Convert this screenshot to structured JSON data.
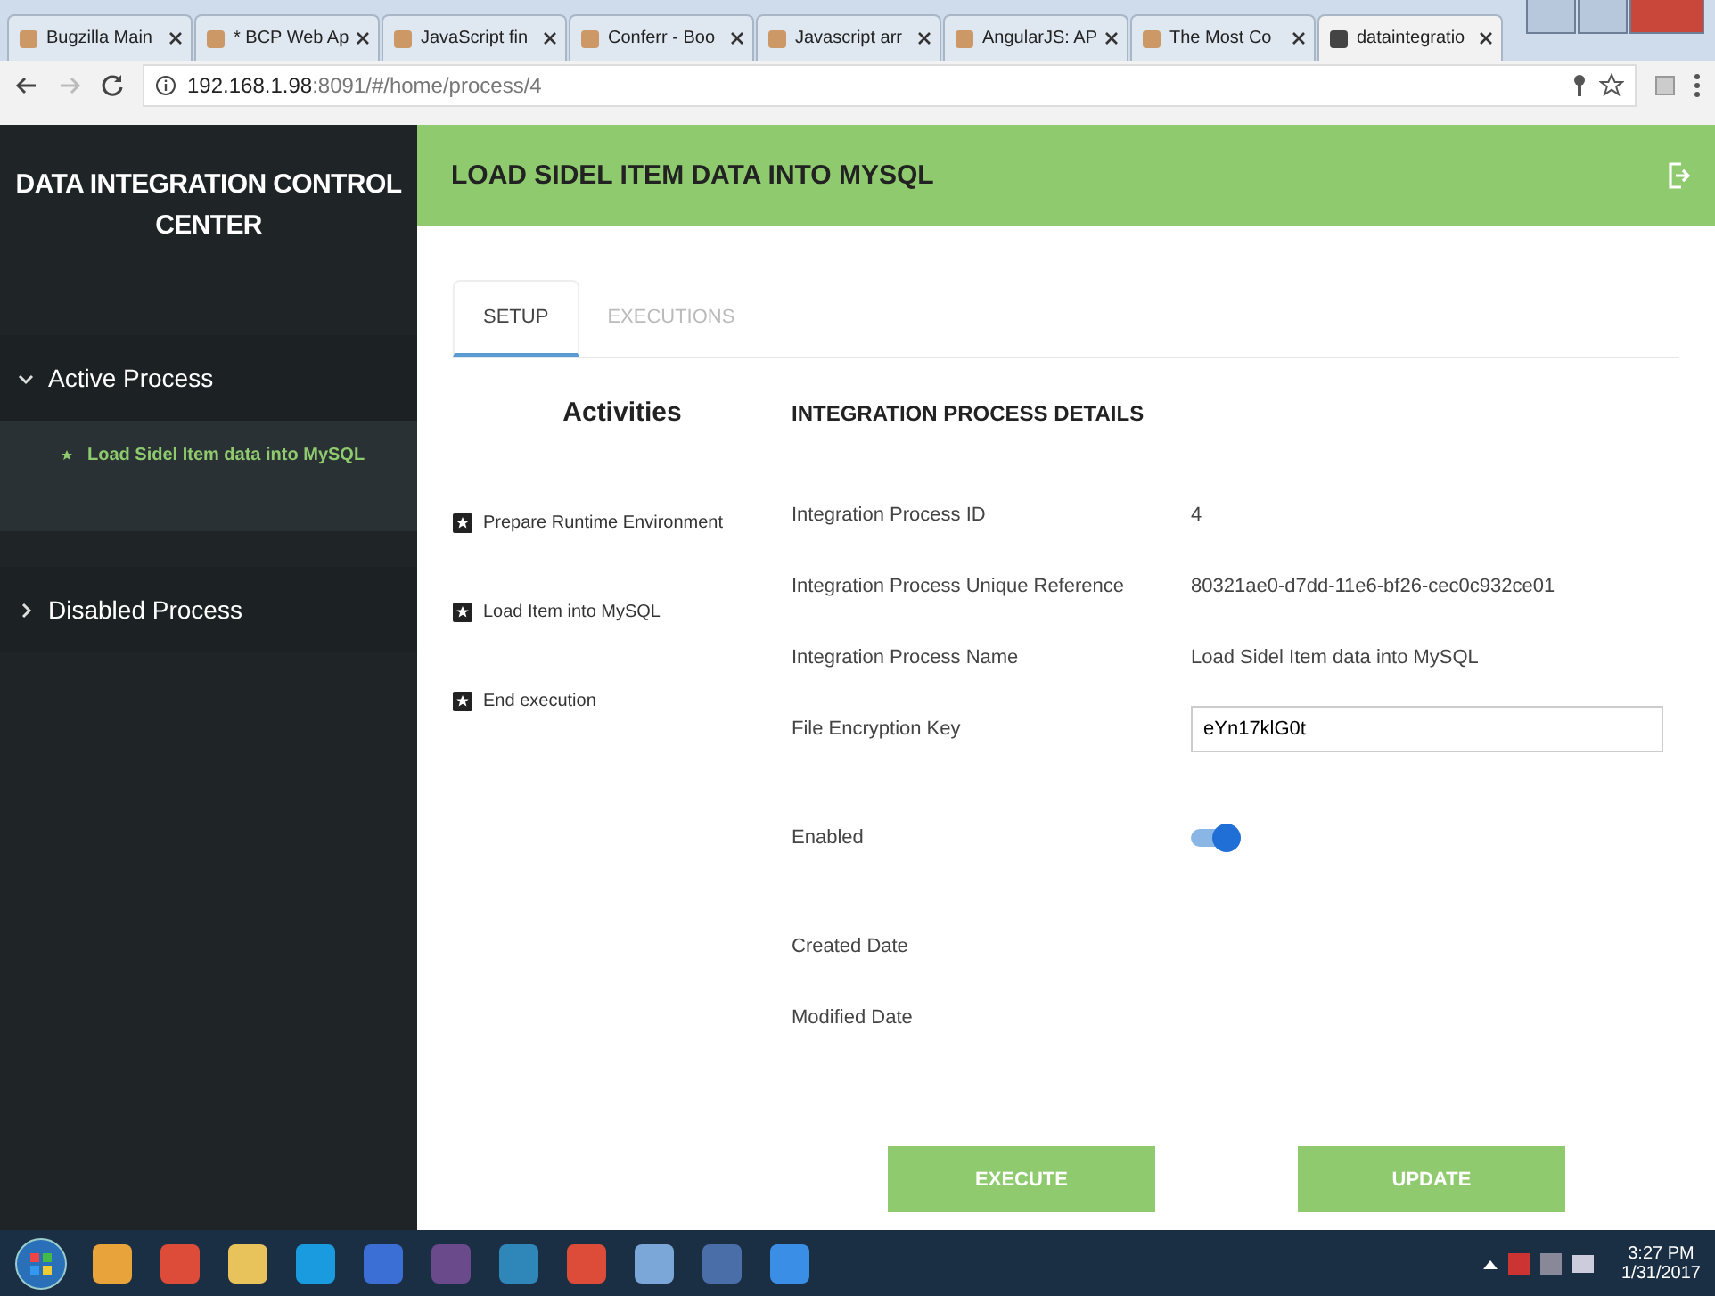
{
  "browser": {
    "tabs": [
      {
        "label": "Bugzilla Main",
        "selected": false
      },
      {
        "label": "* BCP Web Ap",
        "selected": false
      },
      {
        "label": "JavaScript fin",
        "selected": false
      },
      {
        "label": "Conferr - Boo",
        "selected": false
      },
      {
        "label": "Javascript arr",
        "selected": false
      },
      {
        "label": "AngularJS: AP",
        "selected": false
      },
      {
        "label": "The Most Co",
        "selected": false
      },
      {
        "label": "dataintegratio",
        "selected": true
      }
    ],
    "url_host": "192.168.1.98",
    "url_rest": ":8091/#/home/process/4"
  },
  "sidebar": {
    "title": "DATA INTEGRATION CONTROL CENTER",
    "groups": [
      {
        "label": "Active Process",
        "expanded": true,
        "items": [
          {
            "label": "Load Sidel Item data into MySQL",
            "selected": true
          }
        ]
      },
      {
        "label": "Disabled Process",
        "expanded": false
      }
    ]
  },
  "header": {
    "title": "LOAD SIDEL ITEM DATA INTO MYSQL"
  },
  "tabs": [
    {
      "label": "SETUP",
      "selected": true
    },
    {
      "label": "EXECUTIONS",
      "selected": false
    }
  ],
  "activities": {
    "title": "Activities",
    "items": [
      "Prepare Runtime Environment",
      "Load Item into MySQL",
      "End execution"
    ]
  },
  "details": {
    "title": "INTEGRATION PROCESS DETAILS",
    "rows": [
      {
        "kind": "text",
        "label": "Integration Process ID",
        "value": "4"
      },
      {
        "kind": "text",
        "label": "Integration Process Unique Reference",
        "value": "80321ae0-d7dd-11e6-bf26-cec0c932ce01"
      },
      {
        "kind": "text",
        "label": "Integration Process Name",
        "value": "Load Sidel Item data into MySQL"
      },
      {
        "kind": "input",
        "label": "File Encryption Key",
        "value": "eYn17klG0t"
      },
      {
        "kind": "toggle",
        "label": "Enabled",
        "on": true
      },
      {
        "kind": "text",
        "label": "Created Date"
      },
      {
        "kind": "text",
        "label": "Modified Date"
      }
    ]
  },
  "buttons": [
    "EXECUTE",
    "UPDATE"
  ],
  "taskbar": {
    "time": "3:27 PM",
    "date": "1/31/2017"
  }
}
